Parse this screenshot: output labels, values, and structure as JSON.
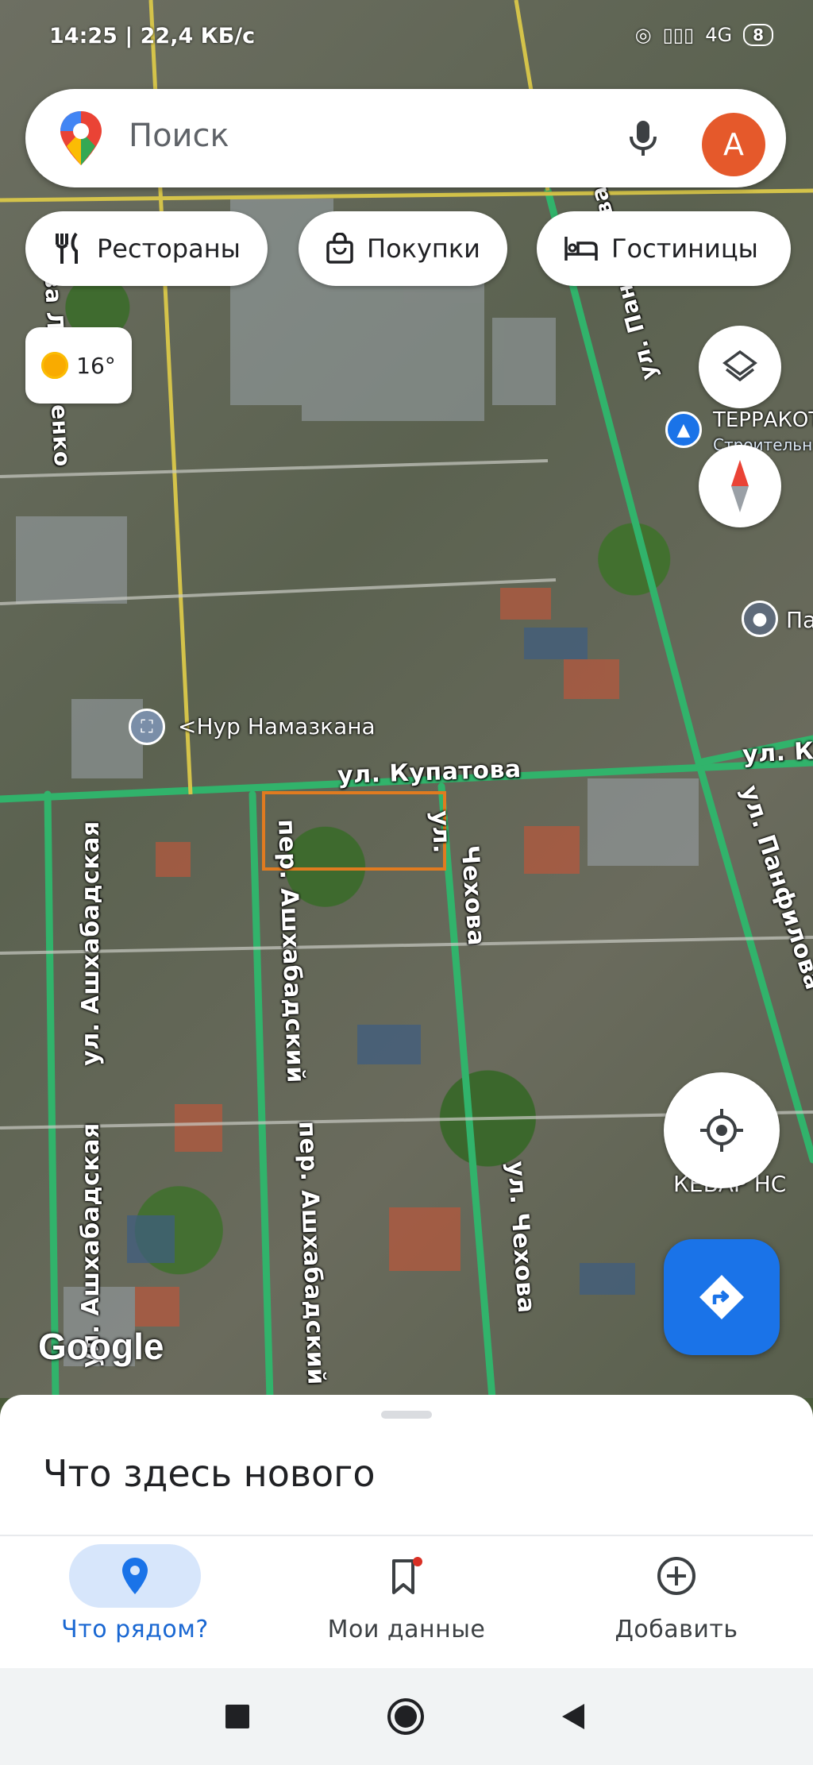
{
  "status_bar": {
    "time": "14:25",
    "speed": "22,4 КБ/с",
    "network": "4G",
    "battery": "8"
  },
  "search": {
    "placeholder": "Поиск",
    "avatar_letter": "A"
  },
  "chips": [
    {
      "label": "Рестораны",
      "icon": "fork-knife-icon"
    },
    {
      "label": "Покупки",
      "icon": "shopping-bag-icon"
    },
    {
      "label": "Гостиницы",
      "icon": "bed-icon"
    }
  ],
  "weather": {
    "temp": "16°",
    "icon": "sun-icon"
  },
  "map": {
    "streets": {
      "logvinenko": "кова Логвиненко",
      "panfilova_top": "ул. Панфилова",
      "panfilova_right": "ул. Панфилова",
      "kupatova": "ул. Купатова",
      "ku_right": "ул. Ку",
      "ashkhabadskaya_top": "ул. Ашхабадская",
      "ashkhabadskaya_bottom": "ул. Ашхабадская",
      "per_ashkhabadsky_top": "пер. Ашхабадский",
      "per_ashkhabadsky_bottom": "пер. Ашхабадский",
      "chekhova_top": "Чехова",
      "chekhova_ul": "ул.",
      "chekhova_bottom": "ул. Чехова"
    },
    "pois": {
      "mosque": "Нур Намазкана",
      "terrakot": "ТЕРРАКОТ",
      "terrakot_sub": "Строительн",
      "pa": "Па",
      "kebab": "КЕБАР НС"
    },
    "attribution": "Google"
  },
  "sheet": {
    "title": "Что здесь нового"
  },
  "bottom_nav": [
    {
      "label": "Что рядом?",
      "active": true
    },
    {
      "label": "Мои данные",
      "active": false
    },
    {
      "label": "Добавить",
      "active": false
    }
  ],
  "colors": {
    "accent": "#1a73e8",
    "avatar": "#e5592b",
    "road": "#31b36b",
    "selection": "#e07b20"
  }
}
